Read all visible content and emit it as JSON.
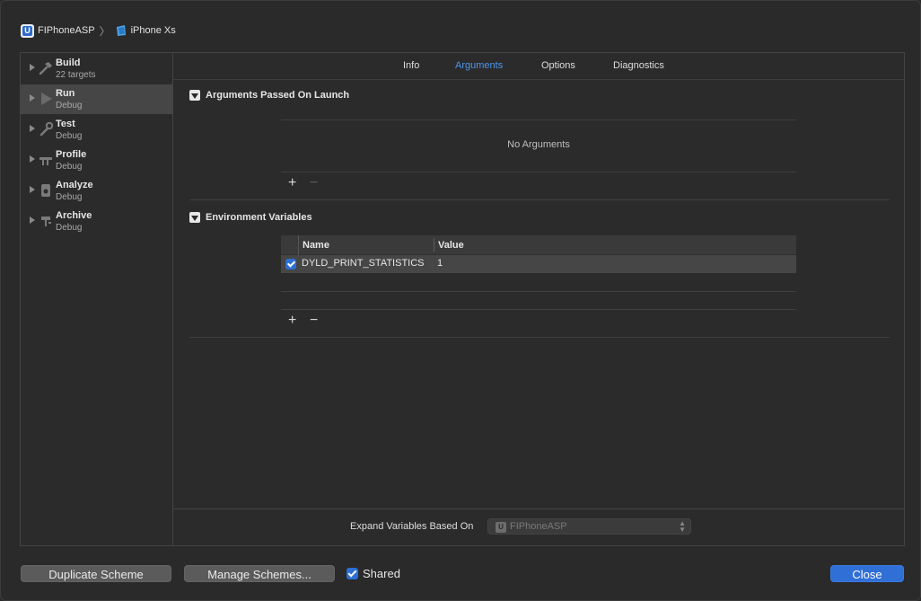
{
  "breadcrumb": {
    "scheme": "FIPhoneASP",
    "scheme_icon_letter": "U",
    "device": "iPhone Xs"
  },
  "sidebar": {
    "items": [
      {
        "title": "Build",
        "subtitle": "22 targets",
        "icon": "hammer-icon",
        "selected": false
      },
      {
        "title": "Run",
        "subtitle": "Debug",
        "icon": "play-icon",
        "selected": true
      },
      {
        "title": "Test",
        "subtitle": "Debug",
        "icon": "wrench-icon",
        "selected": false
      },
      {
        "title": "Profile",
        "subtitle": "Debug",
        "icon": "instruments-icon",
        "selected": false
      },
      {
        "title": "Analyze",
        "subtitle": "Debug",
        "icon": "analyze-icon",
        "selected": false
      },
      {
        "title": "Archive",
        "subtitle": "Debug",
        "icon": "archive-icon",
        "selected": false
      }
    ]
  },
  "tabs": [
    {
      "label": "Info",
      "active": false
    },
    {
      "label": "Arguments",
      "active": true
    },
    {
      "label": "Options",
      "active": false
    },
    {
      "label": "Diagnostics",
      "active": false
    }
  ],
  "arguments_section": {
    "title": "Arguments Passed On Launch",
    "empty_text": "No Arguments",
    "add": "+",
    "remove": "−"
  },
  "env_section": {
    "title": "Environment Variables",
    "columns": {
      "name": "Name",
      "value": "Value"
    },
    "rows": [
      {
        "enabled": true,
        "name": "DYLD_PRINT_STATISTICS",
        "value": "1"
      }
    ],
    "add": "+",
    "remove": "−"
  },
  "expand": {
    "label": "Expand Variables Based On",
    "selected": "FIPhoneASP",
    "icon_letter": "U"
  },
  "footer": {
    "duplicate": "Duplicate Scheme",
    "manage": "Manage Schemes...",
    "shared_label": "Shared",
    "shared_checked": true,
    "close": "Close"
  },
  "colors": {
    "accent": "#2f6fd6",
    "tab_active": "#4e95e8",
    "selected_row": "#464646"
  }
}
